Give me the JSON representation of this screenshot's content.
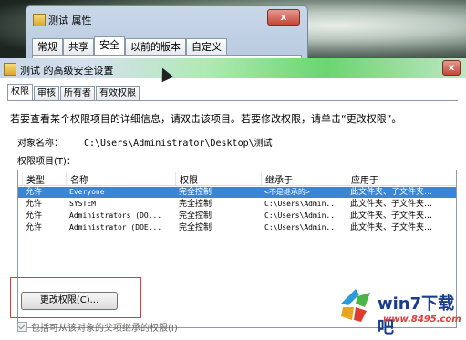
{
  "props_window": {
    "title": "测试 属性",
    "close_glyph": "x",
    "tabs": [
      "常规",
      "共享",
      "安全",
      "以前的版本",
      "自定义"
    ],
    "active_tab": 2
  },
  "adv_window": {
    "title": "测试 的高级安全设置",
    "close_glyph": "x",
    "tabs": [
      "权限",
      "审核",
      "所有者",
      "有效权限"
    ],
    "active_tab": 0,
    "instruction": "若要查看某个权限项目的详细信息，请双击该项目。若要修改权限，请单击“更改权限”。",
    "object_name_label": "对象名称：",
    "object_name_value": "C:\\Users\\Administrator\\Desktop\\测试",
    "entries_label": "权限项目(T)：",
    "table": {
      "columns": [
        "类型",
        "名称",
        "权限",
        "继承于",
        "应用于"
      ],
      "rows": [
        {
          "type": "允许",
          "name": "Everyone",
          "perm": "完全控制",
          "inherited": "<不是继承的>",
          "applies": "此文件夹、子文件夹…",
          "selected": true
        },
        {
          "type": "允许",
          "name": "SYSTEM",
          "perm": "完全控制",
          "inherited": "C:\\Users\\Admin...",
          "applies": "此文件夹、子文件夹…",
          "selected": false
        },
        {
          "type": "允许",
          "name": "Administrators (DO...",
          "perm": "完全控制",
          "inherited": "C:\\Users\\Admin...",
          "applies": "此文件夹、子文件夹…",
          "selected": false
        },
        {
          "type": "允许",
          "name": "Administrator (DOE...",
          "perm": "完全控制",
          "inherited": "C:\\Users\\Admin...",
          "applies": "此文件夹、子文件夹…",
          "selected": false
        }
      ]
    },
    "change_button": "更改权限(C)...",
    "inherit_checkbox": "包括可从该对象的父项继承的权限(I)"
  },
  "watermark": {
    "brand": "win7下载吧",
    "url": "www.8495.com"
  },
  "colors": {
    "selection": "#3a86d6",
    "highlight_box": "#e23a3a",
    "brand_blue": "#1a3e8c"
  }
}
